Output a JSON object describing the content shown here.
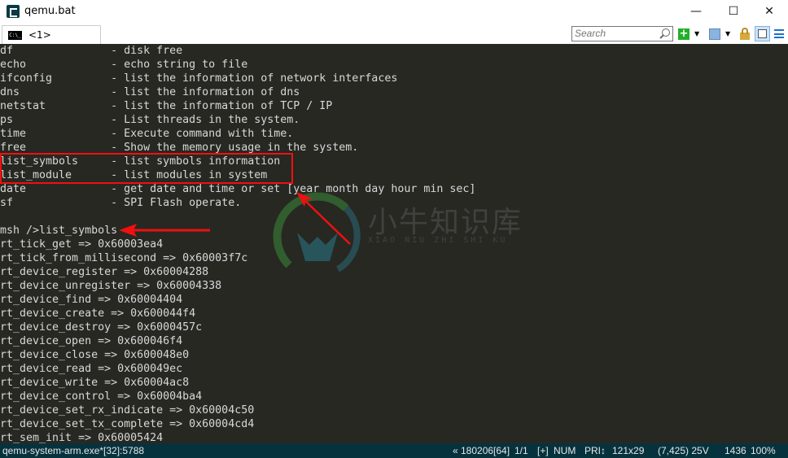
{
  "window": {
    "title": "qemu.bat",
    "minimize_icon": "minimize-icon",
    "maximize_icon": "maximize-icon",
    "close_icon": "close-icon"
  },
  "tab": {
    "label": "<1> qemu.bat",
    "icon_text": "C:\\_"
  },
  "toolbar": {
    "search_placeholder": "Search"
  },
  "terminal": {
    "lines": [
      "df               - disk free",
      "echo             - echo string to file",
      "ifconfig         - list the information of network interfaces",
      "dns              - list the information of dns",
      "netstat          - list the information of TCP / IP",
      "ps               - List threads in the system.",
      "time             - Execute command with time.",
      "free             - Show the memory usage in the system.",
      "list_symbols     - list symbols information",
      "list_module      - list modules in system",
      "date             - get date and time or set [year month day hour min sec]",
      "sf               - SPI Flash operate.",
      "",
      "msh />list_symbols",
      "rt_tick_get => 0x60003ea4",
      "rt_tick_from_millisecond => 0x60003f7c",
      "rt_device_register => 0x60004288",
      "rt_device_unregister => 0x60004338",
      "rt_device_find => 0x60004404",
      "rt_device_create => 0x600044f4",
      "rt_device_destroy => 0x6000457c",
      "rt_device_open => 0x600046f4",
      "rt_device_close => 0x600048e0",
      "rt_device_read => 0x600049ec",
      "rt_device_write => 0x60004ac8",
      "rt_device_control => 0x60004ba4",
      "rt_device_set_rx_indicate => 0x60004c50",
      "rt_device_set_tx_complete => 0x60004cd4",
      "rt_sem_init => 0x60005424"
    ]
  },
  "watermark": {
    "text": "小牛知识库",
    "subtext": "XIAO NIU ZHI SHI KU"
  },
  "statusbar": {
    "process": "qemu-system-arm.exe*[32]:5788",
    "position": "« 180206[64]",
    "page": "1/1",
    "plus": "[+]",
    "num": "NUM",
    "pri": "PRI↕",
    "size": "121x29",
    "coords": "(7,425) 25V",
    "pid": "1436",
    "zoom": "100%"
  },
  "colors": {
    "terminal_bg": "#272822",
    "terminal_fg": "#d8d8d8",
    "annotation": "#f01010",
    "statusbar_bg": "#06323e"
  }
}
